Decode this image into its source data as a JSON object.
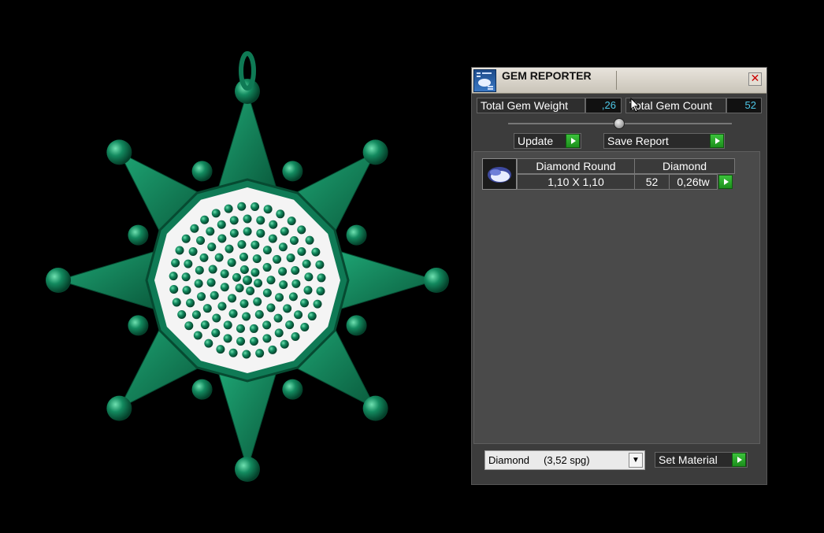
{
  "window": {
    "title": "GEM REPORTER",
    "icons": {
      "app": "gem-reporter-icon",
      "close": "close-icon"
    },
    "close_glyph": "✕"
  },
  "stats": {
    "total_weight_label": "Total Gem Weight",
    "total_weight_value": ",26",
    "total_count_label": "Total Gem Count",
    "total_count_value": "52"
  },
  "actions": {
    "update_label": "Update",
    "save_report_label": "Save Report"
  },
  "gem_list": [
    {
      "icon": "round-gem-icon",
      "shape": "Diamond Round",
      "size": "1,10 X 1,10",
      "material": "Diamond",
      "count": "52",
      "weight": "0,26tw"
    }
  ],
  "material": {
    "selected": "Diamond     (3,52 spg)",
    "set_label": "Set Material"
  },
  "colors": {
    "jewel_green": "#0f7a55",
    "value_cyan": "#4ec8e8",
    "button_green": "#2aa52a",
    "panel_bg": "#3c3c3c"
  }
}
